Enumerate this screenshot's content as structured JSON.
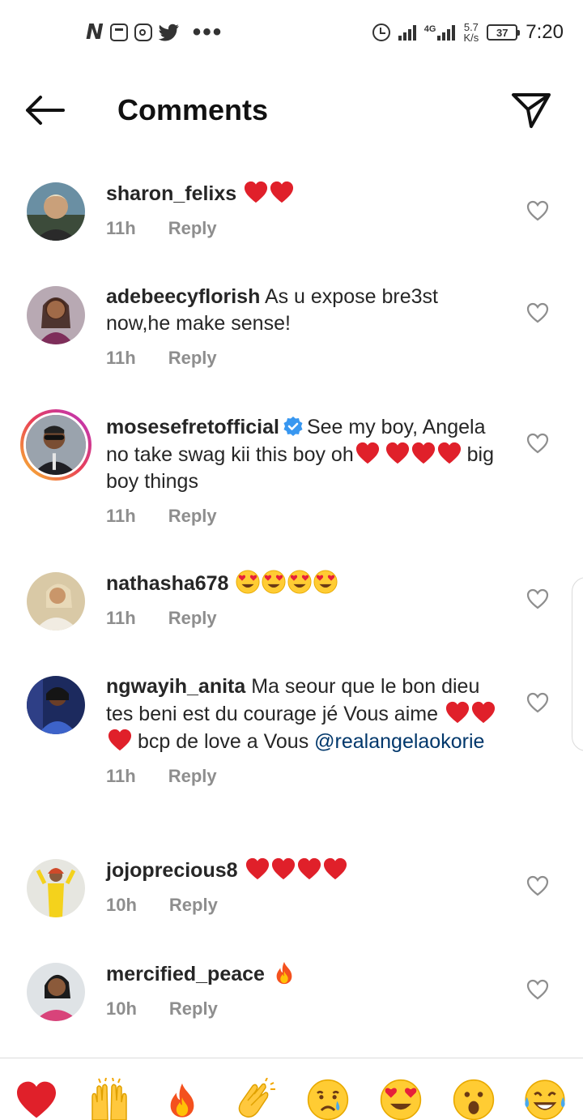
{
  "status_bar": {
    "left_icons": [
      "netflix-icon",
      "sim-icon",
      "instagram-icon",
      "twitter-icon"
    ],
    "more": "•••",
    "network": "4G",
    "speed_value": "5.7",
    "speed_unit": "K/s",
    "battery": "37",
    "time": "7:20"
  },
  "header": {
    "title": "Comments"
  },
  "comments": [
    {
      "username": "sharon_felixs",
      "text": "",
      "emojis": [
        "red-heart",
        "red-heart"
      ],
      "time": "11h",
      "reply": "Reply"
    },
    {
      "username": "adebeecyflorish",
      "text": "As u expose bre3st now,he make sense!",
      "time": "11h",
      "reply": "Reply"
    },
    {
      "username": "mosesefretofficial",
      "verified": true,
      "text_a": "See my boy, Angela no take swag kii this boy oh",
      "emojis": [
        "red-heart",
        "red-heart",
        "red-heart",
        "red-heart"
      ],
      "text_b": " big boy things",
      "time": "11h",
      "reply": "Reply"
    },
    {
      "username": "nathasha678",
      "text": "",
      "emojis": [
        "heart-eyes",
        "heart-eyes",
        "heart-eyes",
        "heart-eyes"
      ],
      "time": "11h",
      "reply": "Reply"
    },
    {
      "username": "ngwayih_anita",
      "text_a": "Ma seour  que le bon dieu tes beni est du courage jé Vous aime ",
      "emojis": [
        "red-heart",
        "red-heart",
        "red-heart"
      ],
      "text_b": " bcp de love a Vous ",
      "mention": "@realangelaokorie",
      "time": "11h",
      "reply": "Reply"
    },
    {
      "username": "jojoprecious8",
      "text": "",
      "emojis": [
        "red-heart",
        "red-heart",
        "red-heart",
        "red-heart"
      ],
      "time": "10h",
      "reply": "Reply"
    },
    {
      "username": "mercified_peace",
      "text": "",
      "emojis": [
        "fire"
      ],
      "time": "10h",
      "reply": "Reply"
    }
  ],
  "emoji_bar": [
    "red-heart",
    "raising-hands",
    "fire",
    "clapping-hands",
    "crying-face",
    "heart-eyes",
    "surprised-face",
    "tears-of-joy"
  ],
  "colors": {
    "heart": "#e0202a",
    "mention": "#00376b",
    "muted": "#8e8e8e",
    "verified": "#3897f0"
  }
}
